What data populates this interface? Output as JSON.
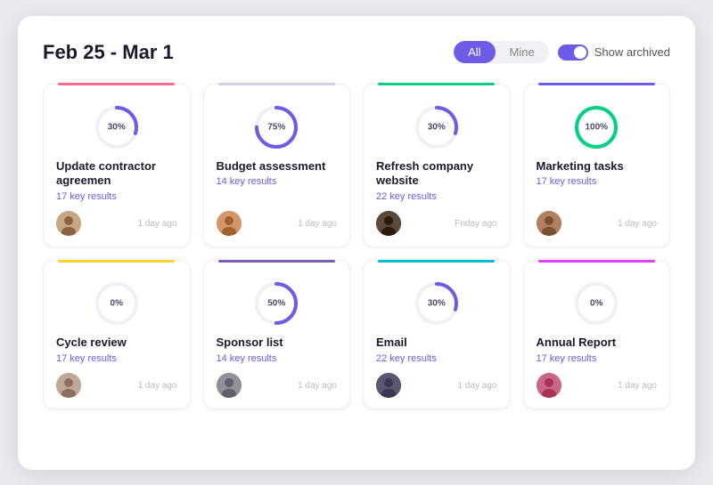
{
  "header": {
    "title": "Feb 25 - Mar 1",
    "filter_all": "All",
    "filter_mine": "Mine",
    "toggle_label": "Show archived"
  },
  "cards": [
    {
      "id": "card-1",
      "border_color": "#ff6b8a",
      "percent": 30,
      "stroke_color": "#6c5ce7",
      "title": "Update contractor agreemen",
      "subtitle": "17 key results",
      "time": "1 day ago",
      "avatar_class": "av1",
      "avatar_symbol": "👤"
    },
    {
      "id": "card-2",
      "border_color": "#d0d0e0",
      "percent": 75,
      "stroke_color": "#6c5ce7",
      "title": "Budget assessment",
      "subtitle": "14 key results",
      "time": "1 day ago",
      "avatar_class": "av2",
      "avatar_symbol": "👤"
    },
    {
      "id": "card-3",
      "border_color": "#00d084",
      "percent": 30,
      "stroke_color": "#6c5ce7",
      "title": "Refresh company website",
      "subtitle": "22 key results",
      "time": "Friday ago",
      "avatar_class": "av3",
      "avatar_symbol": "👤"
    },
    {
      "id": "card-4",
      "border_color": "#6c5ce7",
      "percent": 100,
      "stroke_color": "#00d084",
      "title": "Marketing tasks",
      "subtitle": "17 key results",
      "time": "1 day ago",
      "avatar_class": "av4",
      "avatar_symbol": "👤"
    },
    {
      "id": "card-5",
      "border_color": "#ffd32a",
      "percent": 0,
      "stroke_color": "#6c5ce7",
      "title": "Cycle review",
      "subtitle": "17 key results",
      "time": "1 day ago",
      "avatar_class": "av5",
      "avatar_symbol": "👤"
    },
    {
      "id": "card-6",
      "border_color": "#7c5cbf",
      "percent": 50,
      "stroke_color": "#6c5ce7",
      "title": "Sponsor list",
      "subtitle": "14 key results",
      "time": "1 day ago",
      "avatar_class": "av6",
      "avatar_symbol": "👤"
    },
    {
      "id": "card-7",
      "border_color": "#00bcd4",
      "percent": 30,
      "stroke_color": "#6c5ce7",
      "title": "Email",
      "subtitle": "22 key results",
      "time": "1 day ago",
      "avatar_class": "av7",
      "avatar_symbol": "👤"
    },
    {
      "id": "card-8",
      "border_color": "#e040fb",
      "percent": 0,
      "stroke_color": "#6c5ce7",
      "title": "Annual Report",
      "subtitle": "17 key results",
      "time": "1 day ago",
      "avatar_class": "av8",
      "avatar_symbol": "👤"
    }
  ]
}
